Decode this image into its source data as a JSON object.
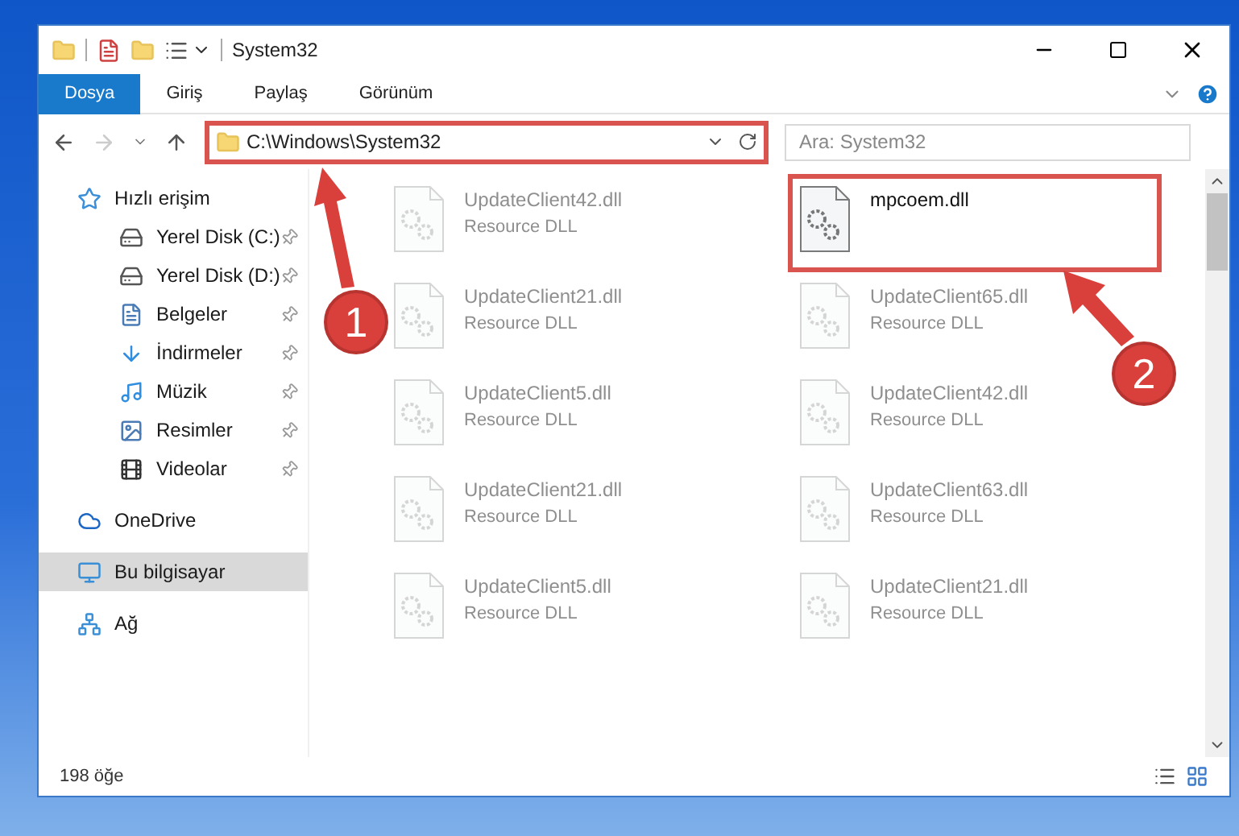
{
  "window": {
    "title": "System32"
  },
  "ribbon_tabs": [
    {
      "label": "Dosya",
      "selected": true
    },
    {
      "label": "Giriş",
      "selected": false
    },
    {
      "label": "Paylaş",
      "selected": false
    },
    {
      "label": "Görünüm",
      "selected": false
    }
  ],
  "address": {
    "path": "C:\\Windows\\System32",
    "highlighted": true
  },
  "search": {
    "placeholder": "Ara: System32"
  },
  "sidebar": {
    "items": [
      {
        "label": "Hızlı erişim",
        "kind": "star",
        "selected": false,
        "children": [
          {
            "label": "Yerel Disk (C:)",
            "kind": "system-drive",
            "pinned": true,
            "selected": false
          },
          {
            "label": "Yerel Disk (D:)",
            "kind": "drive",
            "pinned": true,
            "selected": false
          },
          {
            "label": "Belgeler",
            "kind": "document",
            "pinned": true,
            "selected": false
          },
          {
            "label": "İndirmeler",
            "kind": "download",
            "pinned": true,
            "selected": false
          },
          {
            "label": "Müzik",
            "kind": "music",
            "pinned": true,
            "selected": false
          },
          {
            "label": "Resimler",
            "kind": "image",
            "pinned": true,
            "selected": false
          },
          {
            "label": "Videolar",
            "kind": "film",
            "pinned": true,
            "selected": false
          }
        ]
      },
      {
        "label": "OneDrive",
        "kind": "cloud",
        "selected": false
      },
      {
        "label": "Bu bilgisayar",
        "kind": "computer",
        "selected": true
      },
      {
        "label": "Ağ",
        "kind": "network",
        "selected": false
      }
    ]
  },
  "files": [
    {
      "name": "UpdateClient42.dll",
      "type": "Resource DLL",
      "faded": true,
      "highlighted": false
    },
    {
      "name": "mpcoem.dll",
      "faded": false,
      "highlighted": true
    },
    {
      "name": "UpdateClient21.dll",
      "type": "Resource DLL",
      "faded": true,
      "highlighted": false
    },
    {
      "name": "UpdateClient65.dll",
      "type": "Resource DLL",
      "faded": true,
      "highlighted": false
    },
    {
      "name": "UpdateClient5.dll",
      "type": "Resource DLL",
      "faded": true,
      "highlighted": false
    },
    {
      "name": "UpdateClient42.dll",
      "type": "Resource DLL",
      "faded": true,
      "highlighted": false
    },
    {
      "name": "UpdateClient21.dll",
      "type": "Resource DLL",
      "faded": true,
      "highlighted": false
    },
    {
      "name": "UpdateClient63.dll",
      "type": "Resource DLL",
      "faded": true,
      "highlighted": false
    },
    {
      "name": "UpdateClient5.dll",
      "type": "Resource DLL",
      "faded": true,
      "highlighted": false
    },
    {
      "name": "UpdateClient21.dll",
      "type": "Resource DLL",
      "faded": true,
      "highlighted": false
    }
  ],
  "annotations": [
    {
      "number": "1"
    },
    {
      "number": "2"
    }
  ],
  "status_bar": {
    "count": "198 öğe"
  }
}
